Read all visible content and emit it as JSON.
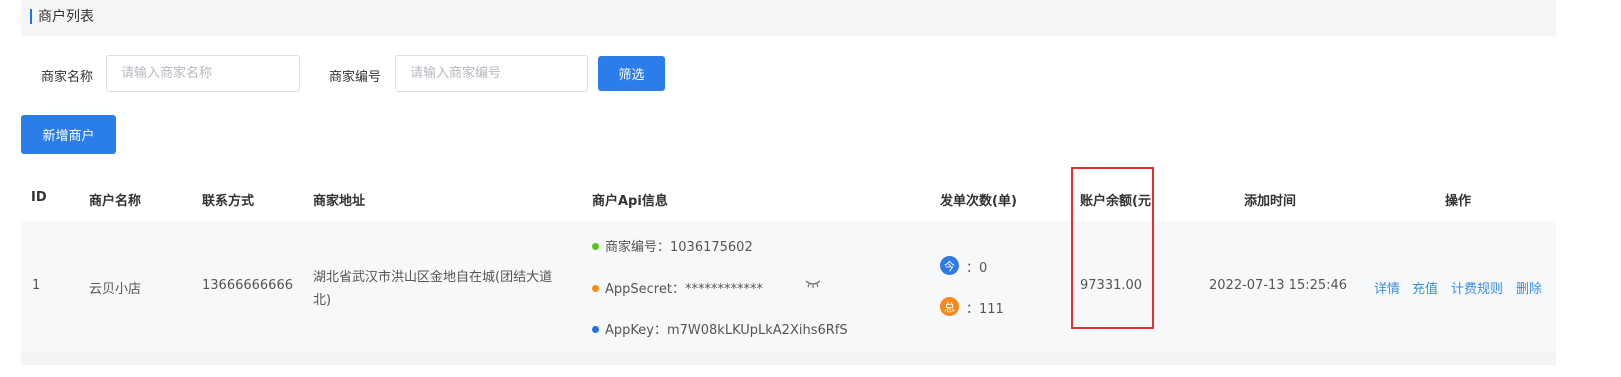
{
  "panel": {
    "title": "商户列表"
  },
  "filters": {
    "name_label": "商家名称",
    "name_placeholder": "请输入商家名称",
    "name_value": "",
    "code_label": "商家编号",
    "code_placeholder": "请输入商家编号",
    "code_value": "",
    "filter_button": "筛选"
  },
  "actions": {
    "add_button": "新增商户"
  },
  "table": {
    "columns": [
      "ID",
      "商户名称",
      "联系方式",
      "商家地址",
      "商户Api信息",
      "发单次数(单)",
      "账户余额(元",
      "添加时间",
      "操作"
    ],
    "rows": [
      {
        "id": "1",
        "name": "云贝小店",
        "phone": "13666666666",
        "address_line1": "湖北省武汉市洪山区金地自在城(团结大道",
        "address_line2": "北)",
        "api_code": "商家编号：1036175602",
        "api_secret": "AppSecret：************",
        "api_key": "AppKey：m7W08kLKUpLkA2Xihs6RfS",
        "today_badge": "今",
        "today_count": "：0",
        "total_badge": "总",
        "total_count": "：111",
        "balance": "97331.00",
        "created_at": "2022-07-13 15:25:46",
        "ops": [
          "详情",
          "充值",
          "计费规则",
          "删除"
        ]
      }
    ]
  },
  "colors": {
    "accent": "#2b7de9",
    "link": "#3a8ee6",
    "dot_green": "#52c41a",
    "dot_orange": "#fa8c16",
    "dot_blue": "#1a73e8",
    "badge_blue": "#2f7be5",
    "badge_orange": "#f5891c",
    "highlight": "#e33131"
  },
  "icons": {
    "secret_toggle": "eye-closed-icon"
  }
}
